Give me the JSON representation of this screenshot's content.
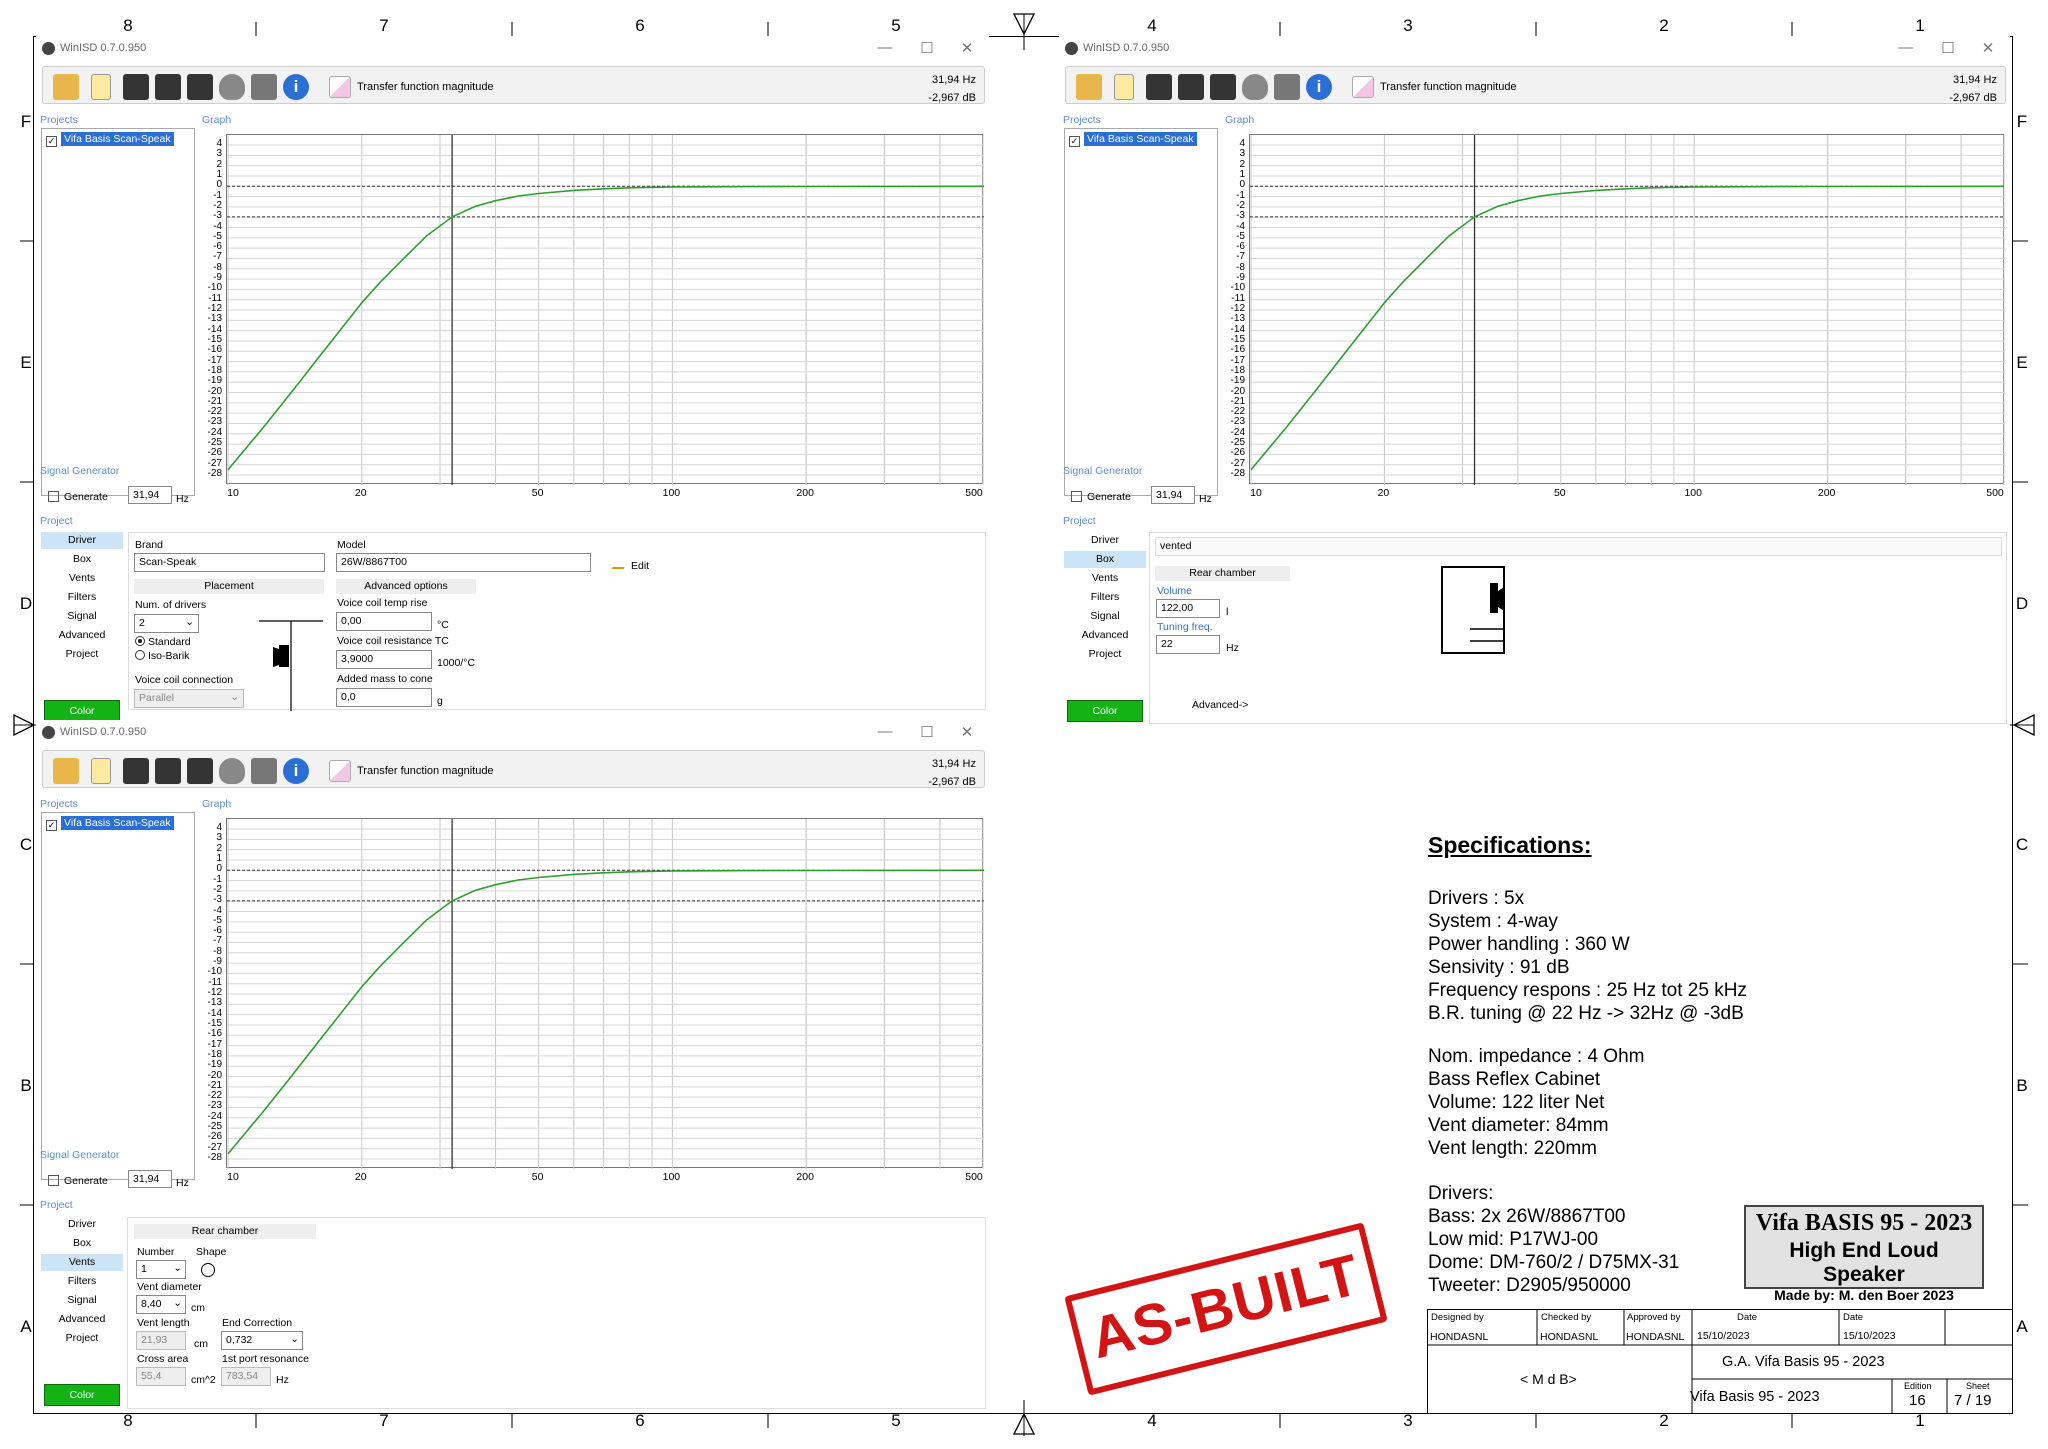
{
  "border": {
    "columns": [
      "8",
      "7",
      "6",
      "5",
      "4",
      "3",
      "2",
      "1"
    ],
    "rows": [
      "F",
      "E",
      "D",
      "C",
      "B",
      "A"
    ]
  },
  "app": {
    "title": "WinISD 0.7.0.950",
    "transfer_label": "Transfer function magnitude",
    "readout_freq": "31,94 Hz",
    "readout_db": "-2,967 dB",
    "projects_label": "Projects",
    "graph_label": "Graph",
    "signal_label": "Signal Generator",
    "project_label": "Project",
    "project_name": "Vifa Basis Scan-Speak",
    "generate_label": "Generate",
    "generate_value": "31,94",
    "hz": "Hz",
    "color_label": "Color",
    "nav": [
      "Driver",
      "Box",
      "Vents",
      "Filters",
      "Signal",
      "Advanced",
      "Project"
    ],
    "y_ticks": [
      "4",
      "3",
      "2",
      "1",
      "0",
      "-1",
      "-2",
      "-3",
      "-4",
      "-5",
      "-6",
      "-7",
      "-8",
      "-9",
      "-10",
      "-11",
      "-12",
      "-13",
      "-14",
      "-15",
      "-16",
      "-17",
      "-18",
      "-19",
      "-20",
      "-21",
      "-22",
      "-23",
      "-24",
      "-25",
      "-26",
      "-27",
      "-28"
    ],
    "x_ticks": [
      "10",
      "20",
      "50",
      "100",
      "200",
      "500"
    ]
  },
  "chart_data": {
    "type": "line",
    "title": "Transfer function magnitude",
    "xlabel": "Hz",
    "ylabel": "dB",
    "x_scale": "log",
    "xlim": [
      10,
      500
    ],
    "ylim": [
      -28,
      4
    ],
    "cursor": {
      "x": 31.94,
      "y": -2.967
    },
    "series": [
      {
        "color": "#2ca02c",
        "x": [
          10,
          12,
          14,
          16,
          18,
          20,
          22,
          25,
          28,
          31.94,
          36,
          40,
          45,
          50,
          60,
          70,
          80,
          100,
          120,
          150,
          200,
          300,
          500
        ],
        "y": [
          -27.5,
          -23.4,
          -19.8,
          -16.6,
          -13.8,
          -11.3,
          -9.3,
          -6.9,
          -4.8,
          -2.97,
          -1.95,
          -1.4,
          -0.95,
          -0.7,
          -0.4,
          -0.25,
          -0.15,
          -0.07,
          -0.05,
          -0.03,
          -0.02,
          -0.01,
          0
        ]
      }
    ]
  },
  "driver_panel": {
    "brand_label": "Brand",
    "brand": "Scan-Speak",
    "model_label": "Model",
    "model": "26W/8867T00",
    "edit": "Edit",
    "placement": "Placement",
    "num_drivers_label": "Num. of drivers",
    "num_drivers": "2",
    "standard": "Standard",
    "isobarik": "Iso-Barik",
    "vc_conn_label": "Voice coil connection",
    "vc_conn": "Parallel",
    "advanced_options": "Advanced options",
    "vc_temp_label": "Voice coil temp rise",
    "vc_temp": "0,00",
    "vc_temp_unit": "°C",
    "vc_res_label": "Voice coil resistance TC",
    "vc_res": "3,9000",
    "vc_res_unit": "1000/°C",
    "added_mass_label": "Added mass to cone",
    "added_mass": "0,0",
    "added_mass_unit": "g"
  },
  "box_panel": {
    "type": "vented",
    "rear_chamber": "Rear chamber",
    "volume_label": "Volume",
    "volume": "122,00",
    "volume_unit": "l",
    "tuning_label": "Tuning freq.",
    "tuning": "22",
    "tuning_unit": "Hz",
    "advanced": "Advanced->"
  },
  "vents_panel": {
    "rear_chamber": "Rear chamber",
    "number_label": "Number",
    "number": "1",
    "shape_label": "Shape",
    "diameter_label": "Vent diameter",
    "diameter": "8,40",
    "diameter_unit": "cm",
    "length_label": "Vent length",
    "length": "21,93",
    "length_unit": "cm",
    "end_corr_label": "End Correction",
    "end_corr": "0,732",
    "cross_label": "Cross area",
    "cross": "55,4",
    "cross_unit": "cm^2",
    "port_res_label": "1st port resonance",
    "port_res": "783,54",
    "port_res_unit": "Hz"
  },
  "specs": {
    "heading": "Specifications:",
    "lines1": [
      "Drivers : 5x",
      "System : 4-way",
      "Power handling : 360 W",
      "Sensivity : 91 dB",
      "Frequency respons : 25 Hz tot 25 kHz",
      "B.R. tuning @ 22 Hz -> 32Hz @ -3dB"
    ],
    "lines2": [
      "Nom. impedance : 4 Ohm",
      "Bass Reflex Cabinet",
      "Volume: 122 liter Net",
      "Vent diameter: 84mm",
      "Vent length: 220mm"
    ],
    "lines3": [
      "Drivers:",
      "Bass: 2x 26W/8867T00",
      "Low mid: P17WJ-00",
      "Dome: DM-760/2 / D75MX-31",
      "Tweeter: D2905/950000"
    ]
  },
  "brand_box": {
    "line1": "Vifa BASIS 95 - 2023",
    "line2": "High End Loud Speaker",
    "line3": "Made by: M. den Boer 2023"
  },
  "stamp": "AS-BUILT",
  "title_block": {
    "designed_label": "Designed by",
    "designed": "HONDASNL",
    "checked_label": "Checked by",
    "checked": "HONDASNL",
    "approved_label": "Approved by",
    "approved": "HONDASNL",
    "date_label": "Date",
    "date1": "15/10/2023",
    "date2": "15/10/2023",
    "maker": "< M d B>",
    "assembly": "G.A. Vifa Basis 95 - 2023",
    "part": "Vifa Basis 95 - 2023",
    "edition_label": "Edition",
    "edition": "16",
    "sheet_label": "Sheet",
    "sheet": "7 / 19"
  }
}
